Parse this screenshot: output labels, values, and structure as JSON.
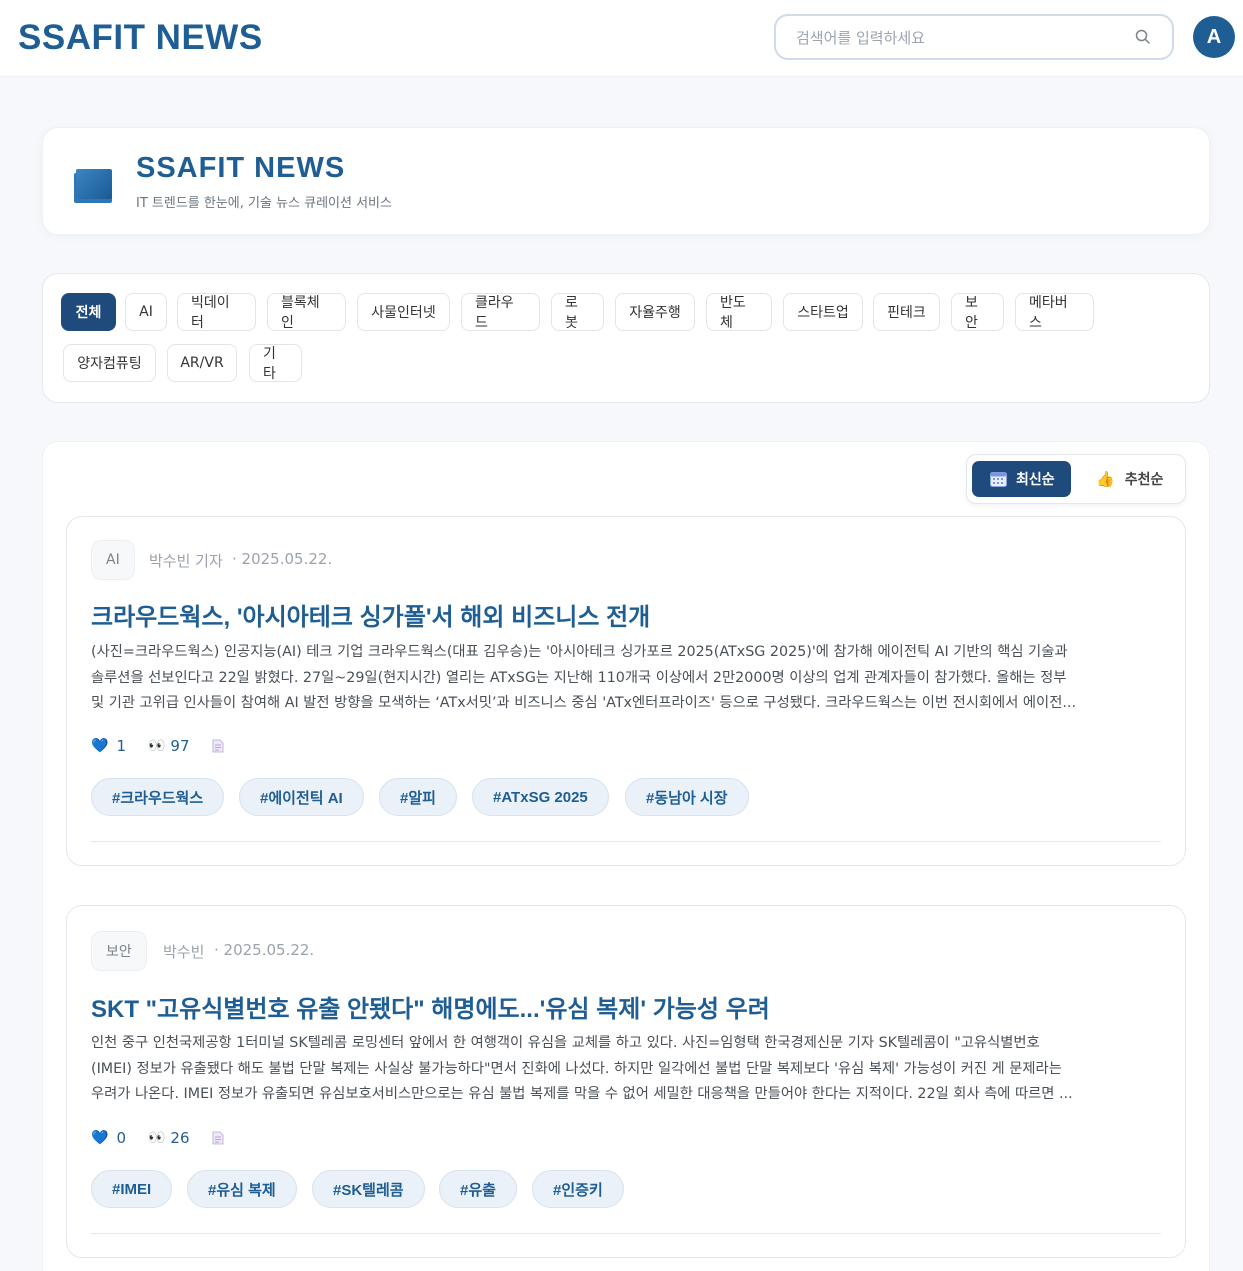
{
  "header": {
    "brand": "SSAFIT NEWS",
    "search_placeholder": "검색어를 입력하세요",
    "avatar_initial": "A"
  },
  "hero": {
    "title": "SSAFIT NEWS",
    "subtitle": "IT 트렌드를 한눈에, 기술 뉴스 큐레이션 서비스"
  },
  "categories": [
    "전체",
    "AI",
    "빅데이터",
    "블록체인",
    "사물인터넷",
    "클라우드",
    "로봇",
    "자율주행",
    "반도체",
    "스타트업",
    "핀테크",
    "보안",
    "메타버스",
    "양자컴퓨팅",
    "AR/VR",
    "기타"
  ],
  "active_category": "전체",
  "sort": {
    "latest": "최신순",
    "recommended": "추천순",
    "active": "최신순"
  },
  "articles": [
    {
      "category": "AI",
      "reporter": "박수빈 기자",
      "date": "· 2025.05.22.",
      "title": "크라우드웍스, '아시아테크 싱가폴'서 해외 비즈니스 전개",
      "summary_lines": [
        "(사진=크라우드웍스) 인공지능(AI) 테크 기업 크라우드웍스(대표 김우승)는 '아시아테크 싱가포르 2025(ATxSG 2025)'에 참가해 에이전틱 AI 기반의 핵심 기술과",
        "솔루션을 선보인다고 22일 밝혔다. 27일~29일(현지시간) 열리는 ATxSG는 지난해 110개국 이상에서 2만2000명 이상의 업계 관계자들이 참가했다. 올해는 정부",
        "및 기관 고위급 인사들이 참여해 AI 발전 방향을 모색하는 ‘ATx서밋’과 비즈니스 중심 'ATx엔터프라이즈' 등으로 구성됐다. 크라우드웍스는 이번 전시회에서 에이전..."
      ],
      "likes": "1",
      "views": "97",
      "tags": [
        "#크라우드웍스",
        "#에이전틱 AI",
        "#알피",
        "#ATxSG 2025",
        "#동남아 시장"
      ]
    },
    {
      "category": "보안",
      "reporter": "박수빈",
      "date": "· 2025.05.22.",
      "title": "SKT \"고유식별번호 유출 안됐다\" 해명에도...'유심 복제' 가능성 우려",
      "summary_lines": [
        "인천 중구 인천국제공항 1터미널 SK텔레콤 로밍센터 앞에서 한 여행객이 유심을 교체를 하고 있다. 사진=임형택 한국경제신문 기자 SK텔레콤이 \"고유식별번호",
        "(IMEI) 정보가 유출됐다 해도 불법 단말 복제는 사실상 불가능하다\"면서 진화에 나섰다. 하지만 일각에선 불법 단말 복제보다 '유심 복제' 가능성이 커진 게 문제라는",
        "우려가 나온다. IMEI 정보가 유출되면 유심보호서비스만으로는 유심 불법 복제를 막을 수 없어 세밀한 대응책을 만들어야 한다는 지적이다. 22일 회사 측에 따르면 ..."
      ],
      "likes": "0",
      "views": "26",
      "tags": [
        "#IMEI",
        "#유심 복제",
        "#SK텔레콤",
        "#유출",
        "#인증키"
      ]
    }
  ],
  "icons": {
    "search": "search-icon",
    "calendar": "calendar-icon",
    "thumbs_up": "thumbs-up-icon",
    "heart": "heart-icon",
    "eyes": "eyes-icon",
    "document": "document-icon"
  },
  "colors": {
    "brand": "#1f5e94",
    "active_chip": "#1f4a7c",
    "tag_bg": "#eaf1f8"
  }
}
